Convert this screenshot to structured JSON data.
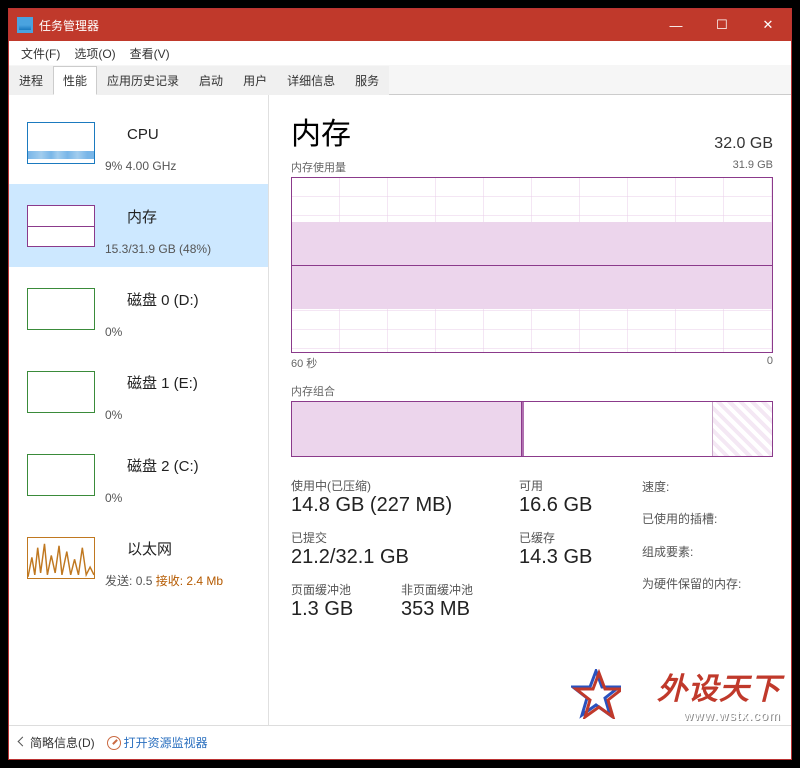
{
  "window": {
    "title": "任务管理器"
  },
  "menu": {
    "file": "文件(F)",
    "options": "选项(O)",
    "view": "查看(V)"
  },
  "tabs": {
    "processes": "进程",
    "performance": "性能",
    "apphistory": "应用历史记录",
    "startup": "启动",
    "users": "用户",
    "details": "详细信息",
    "services": "服务"
  },
  "sidebar": {
    "cpu": {
      "title": "CPU",
      "sub": "9% 4.00 GHz"
    },
    "mem": {
      "title": "内存",
      "sub": "15.3/31.9 GB (48%)"
    },
    "disk0": {
      "title": "磁盘 0 (D:)",
      "sub": "0%"
    },
    "disk1": {
      "title": "磁盘 1 (E:)",
      "sub": "0%"
    },
    "disk2": {
      "title": "磁盘 2 (C:)",
      "sub": "0%"
    },
    "net": {
      "title": "以太网",
      "send_label": "发送:",
      "send": "0.5",
      "recv_label": "接收:",
      "recv": "2.4 Mb"
    }
  },
  "main": {
    "heading": "内存",
    "capacity": "32.0 GB",
    "usage_label": "内存使用量",
    "usage_max": "31.9 GB",
    "x_left": "60 秒",
    "x_right": "0",
    "comp_label": "内存组合",
    "stats": {
      "inuse_label": "使用中(已压缩)",
      "inuse": "14.8 GB (227 MB)",
      "avail_label": "可用",
      "avail": "16.6 GB",
      "commit_label": "已提交",
      "commit": "21.2/32.1 GB",
      "cached_label": "已缓存",
      "cached": "14.3 GB",
      "paged_label": "页面缓冲池",
      "paged": "1.3 GB",
      "nonpaged_label": "非页面缓冲池",
      "nonpaged": "353 MB"
    },
    "info": {
      "speed": "速度:",
      "slots": "已使用的插槽:",
      "form": "组成要素:",
      "reserved": "为硬件保留的内存:"
    }
  },
  "footer": {
    "fewer": "简略信息(D)",
    "resmon": "打开资源监视器"
  },
  "watermark": {
    "text": "外设天下",
    "url": "www.wstx.com"
  },
  "chart_data": {
    "type": "area",
    "title": "内存使用量",
    "ylabel": "GB",
    "ylim": [
      0,
      31.9
    ],
    "xlabel": "秒",
    "xlim": [
      60,
      0
    ],
    "series": [
      {
        "name": "内存使用",
        "approx_constant_value_gb": 15.3
      }
    ],
    "composition_bar": {
      "in_use_gb": 14.8,
      "modified_gb": 0.5,
      "standby_gb": 14.3,
      "free_gb": 1.8,
      "hardware_reserved_visible": true
    }
  }
}
